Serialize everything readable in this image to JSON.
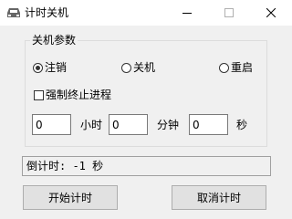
{
  "window": {
    "title": "计时关机",
    "icon": "car-icon",
    "controls": [
      "minimize-icon",
      "maximize-icon",
      "close-icon"
    ]
  },
  "group": {
    "title": "关机参数",
    "options": [
      {
        "label": "注销",
        "checked": true
      },
      {
        "label": "关机",
        "checked": false
      },
      {
        "label": "重启",
        "checked": false
      }
    ],
    "force_close_label": "强制终止进程",
    "force_close_checked": false,
    "hours_value": "0",
    "hours_unit": "小时",
    "minutes_value": "0",
    "minutes_unit": "分钟",
    "seconds_value": "0",
    "seconds_unit": "秒"
  },
  "status": {
    "text": "倒计时: -1 秒"
  },
  "buttons": {
    "start_label": "开始计时",
    "cancel_label": "取消计时"
  }
}
